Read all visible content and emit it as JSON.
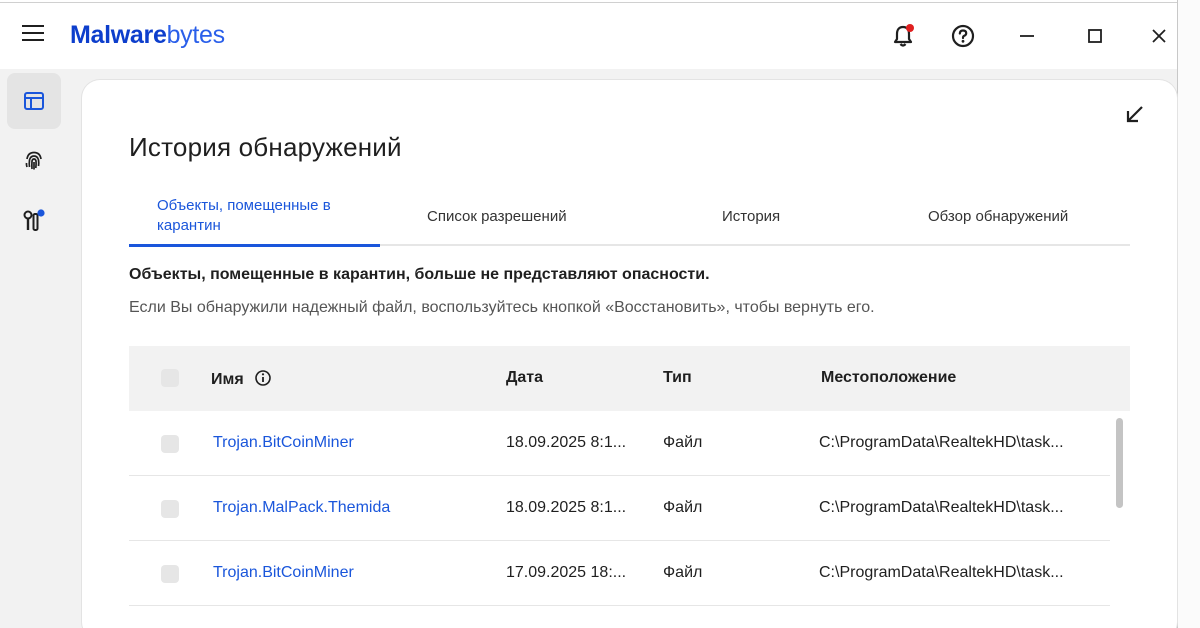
{
  "app": {
    "brand_bold": "Malware",
    "brand_light": "bytes",
    "icons": [
      "menu-icon",
      "bell-icon",
      "help-icon",
      "minimize-icon",
      "maximize-icon",
      "close-icon"
    ],
    "accent_color": "#1a56db"
  },
  "rail": {
    "items": [
      {
        "icon": "dashboard-icon",
        "active": true
      },
      {
        "icon": "fingerprint-icon",
        "active": false
      },
      {
        "icon": "tools-icon",
        "active": false
      }
    ]
  },
  "page": {
    "title": "История обнаружений",
    "tabs": [
      {
        "label": "Объекты, помещенные в карантин",
        "active": true
      },
      {
        "label": "Список разрешений",
        "active": false
      },
      {
        "label": "История",
        "active": false
      },
      {
        "label": "Обзор обнаружений",
        "active": false
      }
    ],
    "notice_bold": "Объекты, помещенные в карантин, больше не представляют опасности.",
    "notice": "Если Вы обнаружили надежный файл, воспользуйтесь кнопкой «Восстановить», чтобы вернуть его."
  },
  "table": {
    "columns": {
      "name": "Имя",
      "date": "Дата",
      "type": "Тип",
      "location": "Местоположение"
    },
    "rows": [
      {
        "name": "Trojan.BitCoinMiner",
        "date": "18.09.2025 8:1...",
        "type": "Файл",
        "location": "C:\\ProgramData\\RealtekHD\\task..."
      },
      {
        "name": "Trojan.MalPack.Themida",
        "date": "18.09.2025 8:1...",
        "type": "Файл",
        "location": "C:\\ProgramData\\RealtekHD\\task..."
      },
      {
        "name": "Trojan.BitCoinMiner",
        "date": "17.09.2025 18:...",
        "type": "Файл",
        "location": "C:\\ProgramData\\RealtekHD\\task..."
      }
    ]
  }
}
